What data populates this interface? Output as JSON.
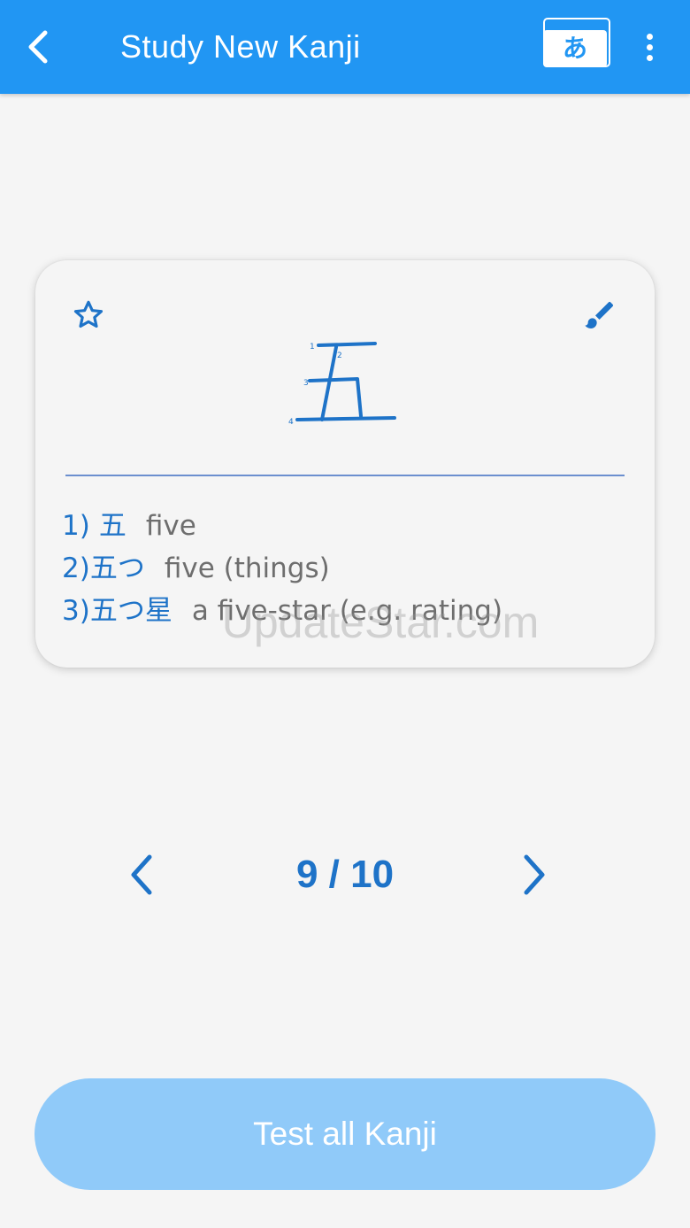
{
  "appbar": {
    "title": "Study New Kanji",
    "kana_button_glyph": "あ",
    "background_color": "#2196f3"
  },
  "card": {
    "kanji": "五",
    "stroke_numbers": [
      "1",
      "2",
      "3",
      "4"
    ],
    "vocab": [
      {
        "num": "1)",
        "word": "五",
        "meaning": "five"
      },
      {
        "num": "2)",
        "word": "五つ",
        "meaning": "five (things)"
      },
      {
        "num": "3)",
        "word": "五つ星",
        "meaning": "a five-star (e.g. rating)"
      }
    ],
    "watermark": "UpdateStar.com",
    "accent_color": "#1e73c8"
  },
  "pager": {
    "label": "9 / 10",
    "current": 9,
    "total": 10
  },
  "footer": {
    "test_button_label": "Test all Kanji",
    "button_color": "#90caf9"
  },
  "icons": {
    "back": "chevron-left-icon",
    "kana": "kana-flashcards-icon",
    "more": "more-vert-icon",
    "favorite": "star-outline-icon",
    "draw": "brush-icon",
    "prev": "chevron-left-icon",
    "next": "chevron-right-icon"
  }
}
